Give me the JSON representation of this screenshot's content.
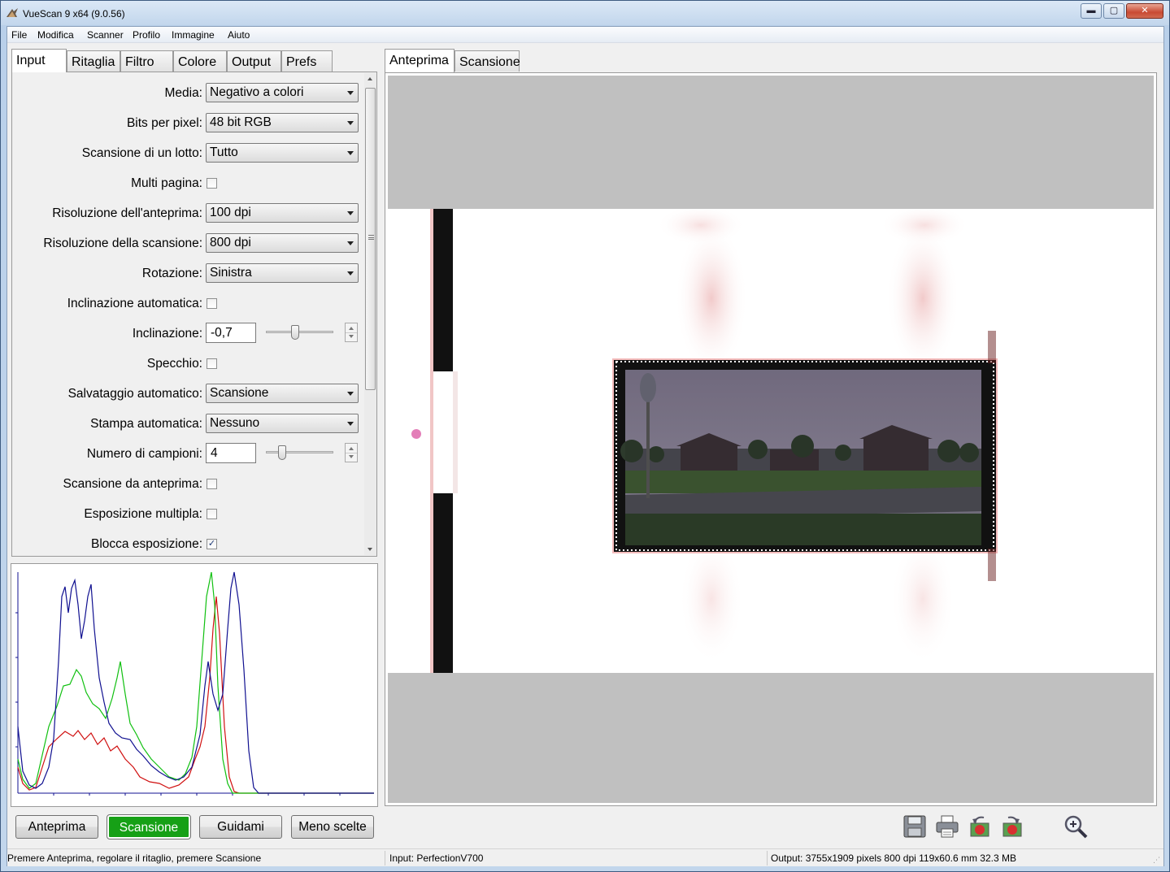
{
  "window": {
    "title": "VueScan 9 x64 (9.0.56)",
    "controls": {
      "minimize": "▬",
      "maximize": "▢",
      "close": "✕"
    }
  },
  "menu": [
    "File",
    "Modifica",
    "Scanner",
    "Profilo",
    "Immagine",
    "Aiuto"
  ],
  "left_tabs": [
    "Input",
    "Ritaglia",
    "Filtro",
    "Colore",
    "Output",
    "Prefs"
  ],
  "right_tabs": [
    "Anteprima",
    "Scansione"
  ],
  "settings": {
    "media": {
      "label": "Media:",
      "value": "Negativo a colori"
    },
    "bits": {
      "label": "Bits per pixel:",
      "value": "48 bit RGB"
    },
    "batch": {
      "label": "Scansione di un lotto:",
      "value": "Tutto"
    },
    "multipage": {
      "label": "Multi pagina:",
      "checked": false
    },
    "preview_res": {
      "label": "Risoluzione dell'anteprima:",
      "value": "100 dpi"
    },
    "scan_res": {
      "label": "Risoluzione della scansione:",
      "value": "800 dpi"
    },
    "rotation": {
      "label": "Rotazione:",
      "value": "Sinistra"
    },
    "auto_skew": {
      "label": "Inclinazione automatica:",
      "checked": false
    },
    "skew": {
      "label": "Inclinazione:",
      "value": "-0,7"
    },
    "mirror": {
      "label": "Specchio:",
      "checked": false
    },
    "auto_save": {
      "label": "Salvataggio automatico:",
      "value": "Scansione"
    },
    "auto_print": {
      "label": "Stampa automatica:",
      "value": "Nessuno"
    },
    "samples": {
      "label": "Numero di campioni:",
      "value": "4"
    },
    "scan_from_preview": {
      "label": "Scansione da anteprima:",
      "checked": false
    },
    "multi_exposure": {
      "label": "Esposizione multipla:",
      "checked": false
    },
    "lock_exposure": {
      "label": "Blocca esposizione:",
      "checked": true,
      "mark": "✓"
    }
  },
  "buttons": {
    "preview": "Anteprima",
    "scan": "Scansione",
    "guide": "Guidami",
    "fewer": "Meno scelte"
  },
  "colors": {
    "scan_button": "#16a016",
    "hist_red": "#d01010",
    "hist_green": "#10c010",
    "hist_blue": "#101090"
  },
  "toolbar_icons": [
    "save-icon",
    "print-icon",
    "rotate-left-icon",
    "rotate-right-icon",
    "zoom-in-icon"
  ],
  "status": {
    "hint": "Premere Anteprima, regolare il ritaglio, premere Scansione",
    "input": "Input: PerfectionV700",
    "output": "Output: 3755x1909 pixels 800 dpi 119x60.6 mm 32.3 MB"
  }
}
